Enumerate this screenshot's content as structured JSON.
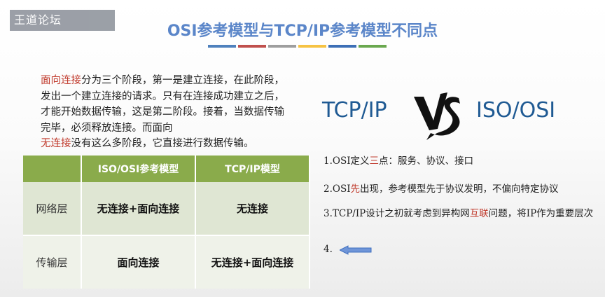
{
  "watermark": "王道论坛",
  "title": "OSI参考模型与TCP/IP参考模型不同点",
  "title_bar_colors": [
    "#4f81bd",
    "#c0504d",
    "#9e9e9e",
    "#f6c343",
    "#3d6fb6",
    "#6aa84f"
  ],
  "intro": {
    "part1_red": "面向连接",
    "part1_rest": "分为三个阶段，第一是建立连接，在此阶段，发出一个建立连接的请求。只有在连接成功建立之后，才能开始数据传输，这是第二阶段。接着，当数据传输完毕，必须释放连接。而面向",
    "part2_red": "无连接",
    "part2_rest": "没有这么多阶段，它直接进行数据传输。"
  },
  "table": {
    "headers": [
      "",
      "ISO/OSI参考模型",
      "TCP/IP模型"
    ],
    "rows": [
      {
        "layer": "网络层",
        "osi": "无连接+面向连接",
        "tcpip": "无连接"
      },
      {
        "layer": "传输层",
        "osi": "面向连接",
        "tcpip": "无连接+面向连接"
      }
    ]
  },
  "vs": {
    "left": "TCP/IP",
    "right": "ISO/OSI",
    "logo_icon": "vs-brush-logo"
  },
  "points": {
    "p1_a": "1.OSI定义",
    "p1_red": "三",
    "p1_b": "点：服务、协议、接口",
    "p2_a": "2.OSI",
    "p2_red": "先",
    "p2_b": "出现，参考模型先于协议发明，不偏向特定协议",
    "p3_a": "3.TCP/IP设计之初就考虑到异构网",
    "p3_red": "互联",
    "p3_b": "问题，将IP作为重要层次",
    "p4": "4.",
    "arrow_icon": "left-arrow-icon"
  }
}
